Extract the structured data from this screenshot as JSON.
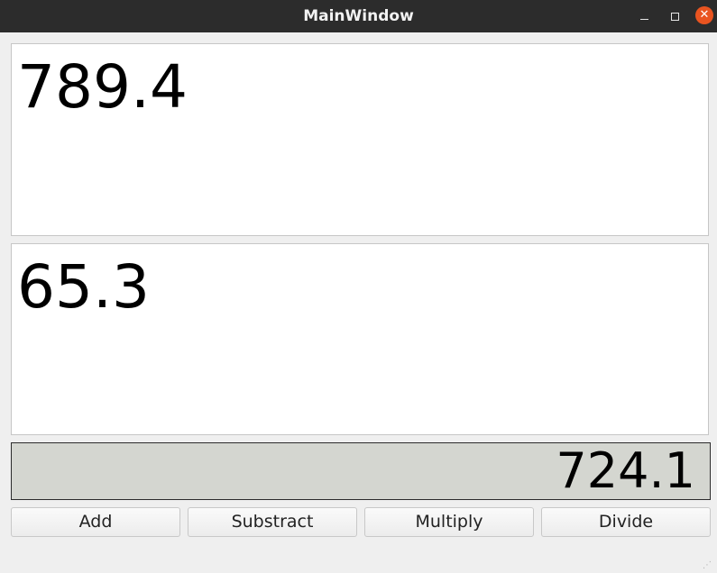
{
  "window": {
    "title": "MainWindow"
  },
  "inputs": {
    "first_value": "789.4",
    "second_value": "65.3"
  },
  "result": {
    "value": "724.1"
  },
  "buttons": {
    "add": "Add",
    "subtract": "Substract",
    "multiply": "Multiply",
    "divide": "Divide"
  },
  "colors": {
    "titlebar": "#2c2c2c",
    "close_button": "#e95420",
    "result_background": "#d4d6d0"
  }
}
